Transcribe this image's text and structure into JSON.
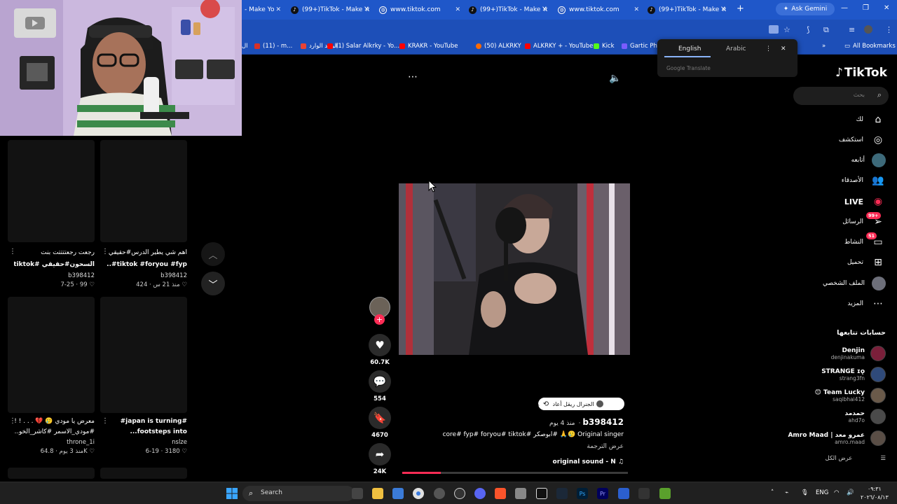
{
  "browser": {
    "tabs": [
      {
        "title": "- Make Yo",
        "icon": "tiktok-icon"
      },
      {
        "title": "(99+)TikTok - Make Yo",
        "icon": "tiktok-icon"
      },
      {
        "title": "www.tiktok.com",
        "icon": "globe-icon"
      },
      {
        "title": "(99+)TikTok - Make Yo",
        "icon": "tiktok-icon"
      },
      {
        "title": "www.tiktok.com",
        "icon": "globe-icon"
      },
      {
        "title": "(99+)TikTok - Make Yo",
        "icon": "tiktok-icon"
      }
    ],
    "ask_gemini": "Ask Gemini",
    "bookmarks": [
      {
        "label": "ال",
        "color": "#3aa0ff"
      },
      {
        "label": "(11) - m...",
        "color": "#d93025"
      },
      {
        "label": "البريد الوارد",
        "color": "#ea4335"
      },
      {
        "label": "(1) Salar Alkrky - Yo...",
        "color": "#ff0000"
      },
      {
        "label": "KRAKR - YouTube",
        "color": "#ff0000"
      },
      {
        "label": "(50) ALKRKY",
        "color": "#ff6a00"
      },
      {
        "label": "ALKRKY + - YouTube",
        "color": "#ff0000"
      },
      {
        "label": "Kick",
        "color": "#53fc18"
      },
      {
        "label": "Gartic Pho",
        "color": "#7a5cff"
      }
    ],
    "all_bookmarks": "All Bookmarks"
  },
  "translate": {
    "lang_from": "English",
    "lang_to": "Arabic",
    "powered": "Google Translate"
  },
  "grid": {
    "cards": [
      {
        "title1": "اهم شي يطير الدرس#حقيقي",
        "title2": "tiktok #foryou #fyp#...",
        "author": "b398412",
        "likes": "424",
        "age": "منذ 21 س"
      },
      {
        "title1": "رجعت رجعتتتتت بنت",
        "title2": "السحون#حقيقي #tiktok...",
        "author": "b398412",
        "likes": "99",
        "age": "7-25"
      },
      {
        "title1": "#japan is turning#",
        "title2": "footsteps into...",
        "author": "nslze",
        "likes": "3180",
        "age": "6-19"
      },
      {
        "title1": "معرض يا مودي 🥲 💔 . . . ! !",
        "title2": "#مودي_الاسمر #كاشر_الخو...",
        "author": "throne_1i",
        "likes": "64.8K",
        "age": "منذ 3 يوم"
      }
    ]
  },
  "video": {
    "likes": "60.7K",
    "comments": "554",
    "saves": "4670",
    "shares": "24K",
    "repost_text": "الجنرال ريقل أعاد نشره",
    "author": "b398412",
    "age": "منذ 4 يوم",
    "caption": "core# fyp# foryou# tiktok# ابوصكر# 🙏🥲 Original singer",
    "see_translation": "عرض الترجمة",
    "sound": "original sound - N",
    "progress_fraction": 0.17
  },
  "sidebar": {
    "logo": "TikTok",
    "search_placeholder": "بحث",
    "nav": [
      {
        "label": "لك",
        "icon": "home-icon",
        "glyph": "⌂"
      },
      {
        "label": "استكشف",
        "icon": "compass-icon",
        "glyph": "◎"
      },
      {
        "label": "أتابعه",
        "icon": "following-avatar-icon",
        "glyph": "●"
      },
      {
        "label": "الأصدقاء",
        "icon": "friends-icon",
        "glyph": "👥"
      },
      {
        "label": "LIVE",
        "icon": "live-icon",
        "glyph": "◉"
      },
      {
        "label": "الرسائل",
        "icon": "messages-icon",
        "glyph": "➢",
        "badge": "99+"
      },
      {
        "label": "النشاط",
        "icon": "activity-icon",
        "glyph": "▭",
        "badge": "51"
      },
      {
        "label": "تحميل",
        "icon": "upload-icon",
        "glyph": "⊞"
      },
      {
        "label": "الملف الشخصي",
        "icon": "profile-icon",
        "glyph": "●"
      },
      {
        "label": "المزيد",
        "icon": "more-icon",
        "glyph": "⋯"
      }
    ],
    "following_header": "حسابات تتابعها",
    "accounts": [
      {
        "name": "Denjin",
        "handle": "denjinakuma"
      },
      {
        "name": "STRANGE ɪǫ",
        "handle": "strang3fn"
      },
      {
        "name": "😊 Team Lucky",
        "handle": "saqibhai412"
      },
      {
        "name": "حمدمد",
        "handle": "ahd7o"
      },
      {
        "name": "Amro Maad | عمرو معد",
        "handle": "amro.maad"
      }
    ],
    "see_all": "عرض الكل"
  },
  "taskbar": {
    "search": "Search",
    "lang": "ENG",
    "time": "٠٩:٣١",
    "date": "٢٠٢٦/٠٨/١٣"
  }
}
